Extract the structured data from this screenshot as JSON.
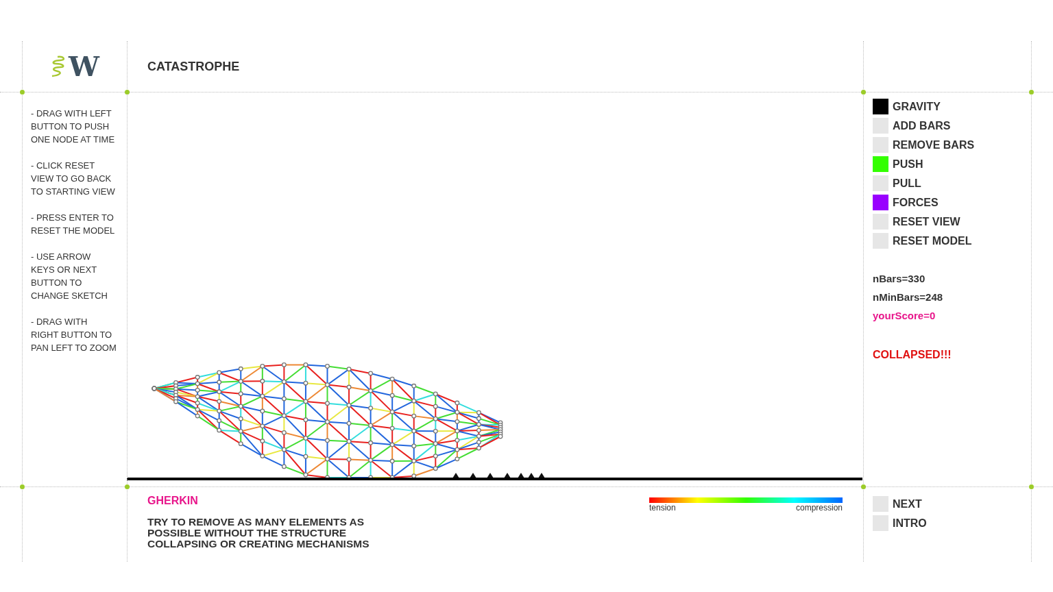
{
  "logo": {
    "text": "W"
  },
  "title": "CATASTROPHE",
  "instructions": [
    "- DRAG WITH LEFT BUTTON TO PUSH ONE NODE AT TIME",
    "- CLICK RESET VIEW TO GO BACK TO STARTING VIEW",
    "- PRESS ENTER TO RESET THE MODEL",
    "- USE ARROW KEYS OR NEXT BUTTON TO CHANGE SKETCH",
    "- DRAG WITH RIGHT BUTTON TO PAN LEFT TO ZOOM"
  ],
  "controls": [
    {
      "label": "GRAVITY",
      "on": true,
      "color": "#000000"
    },
    {
      "label": "ADD BARS",
      "on": false
    },
    {
      "label": "REMOVE BARS",
      "on": false
    },
    {
      "label": "PUSH",
      "on": true,
      "color": "#33ff00"
    },
    {
      "label": "PULL",
      "on": false
    },
    {
      "label": "FORCES",
      "on": true,
      "color": "#9900ff"
    },
    {
      "label": "RESET VIEW",
      "on": false
    },
    {
      "label": "RESET MODEL",
      "on": false
    }
  ],
  "stats": [
    {
      "text": "nBars=330",
      "kind": "plain"
    },
    {
      "text": "nMinBars=248",
      "kind": "plain"
    },
    {
      "text": "yourScore=0",
      "kind": "score"
    }
  ],
  "status": "COLLAPSED!!!",
  "sketch_name": "GHERKIN",
  "task": "TRY TO REMOVE AS MANY ELEMENTS AS POSSIBLE WITHOUT THE STRUCTURE COLLAPSING OR CREATING MECHANISMS",
  "legend": {
    "low_label": "tension",
    "high_label": "compression"
  },
  "nav_buttons": [
    {
      "label": "NEXT"
    },
    {
      "label": "INTRO"
    }
  ]
}
